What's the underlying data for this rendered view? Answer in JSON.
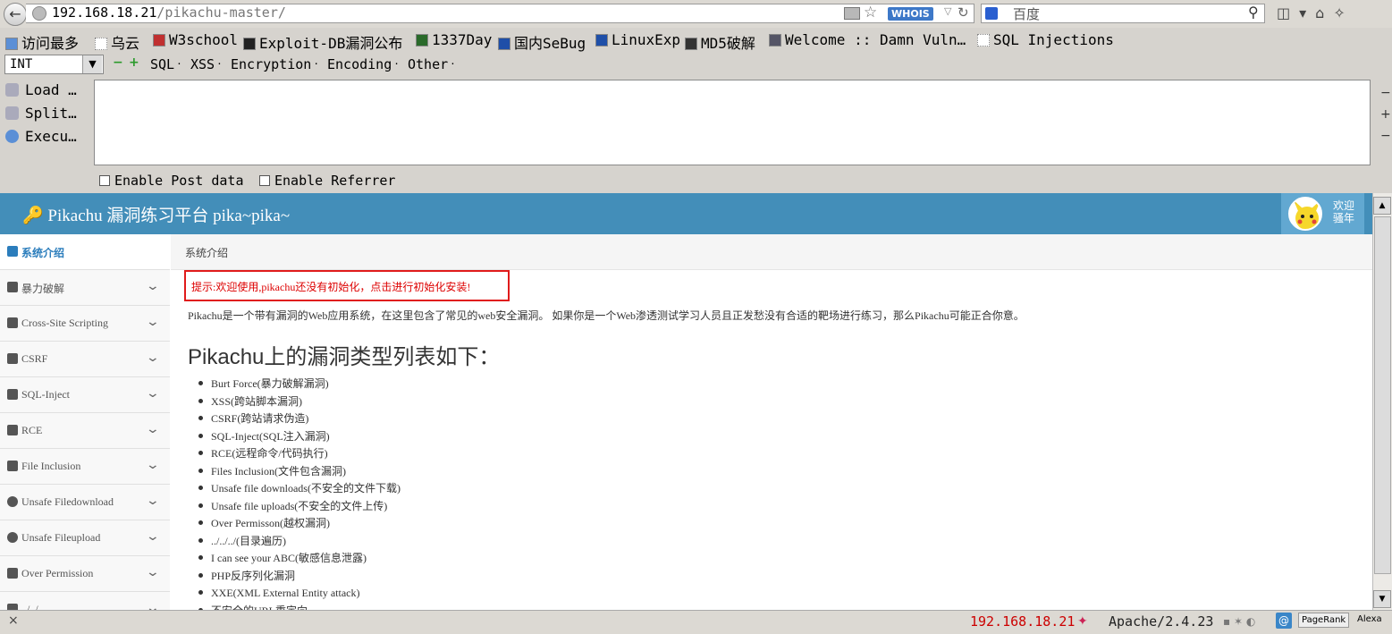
{
  "browser": {
    "url_host": "192.168.18.21",
    "url_path": "/pikachu-master/",
    "whois_label": "WHOIS",
    "search_placeholder": "百度"
  },
  "bookmarks": [
    "访问最多",
    "乌云",
    "W3school",
    "Exploit-DB漏洞公布",
    "1337Day",
    "国内SeBug",
    "LinuxExp",
    "MD5破解",
    "Welcome :: Damn Vuln…",
    "SQL Injections"
  ],
  "hackbar": {
    "select_value": "INT",
    "menus": [
      "SQL",
      "XSS",
      "Encryption",
      "Encoding",
      "Other"
    ],
    "side": [
      "Load …",
      "Split…",
      "Execu…"
    ],
    "enable_post": "Enable Post data",
    "enable_referrer": "Enable Referrer"
  },
  "page": {
    "logo": "Pikachu 漏洞练习平台 pika~pika~",
    "welcome_line1": "欢迎",
    "welcome_line2": "骚年",
    "breadcrumb": "系统介绍",
    "tip": "提示:欢迎使用,pikachu还没有初始化，点击进行初始化安装!",
    "intro": "Pikachu是一个带有漏洞的Web应用系统，在这里包含了常见的web安全漏洞。 如果你是一个Web渗透测试学习人员且正发愁没有合适的靶场进行练习，那么Pikachu可能正合你意。",
    "heading": "Pikachu上的漏洞类型列表如下：",
    "vulns": [
      "Burt Force(暴力破解漏洞)",
      "XSS(跨站脚本漏洞)",
      "CSRF(跨站请求伪造)",
      "SQL-Inject(SQL注入漏洞)",
      "RCE(远程命令/代码执行)",
      "Files Inclusion(文件包含漏洞)",
      "Unsafe file downloads(不安全的文件下载)",
      "Unsafe file uploads(不安全的文件上传)",
      "Over Permisson(越权漏洞)",
      "../../../(目录遍历)",
      "I can see your ABC(敏感信息泄露)",
      "PHP反序列化漏洞",
      "XXE(XML External Entity attack)",
      "不安全的URL重定向"
    ]
  },
  "sidebar": [
    "系统介绍",
    "暴力破解",
    "Cross-Site Scripting",
    "CSRF",
    "SQL-Inject",
    "RCE",
    "File Inclusion",
    "Unsafe Filedownload",
    "Unsafe Fileupload",
    "Over Permission",
    "../../"
  ],
  "statusbar": {
    "close": "×",
    "ip": "192.168.18.21",
    "server": "Apache/2.4.23",
    "pagerank": "PageRank",
    "alexa": "Alexa"
  }
}
